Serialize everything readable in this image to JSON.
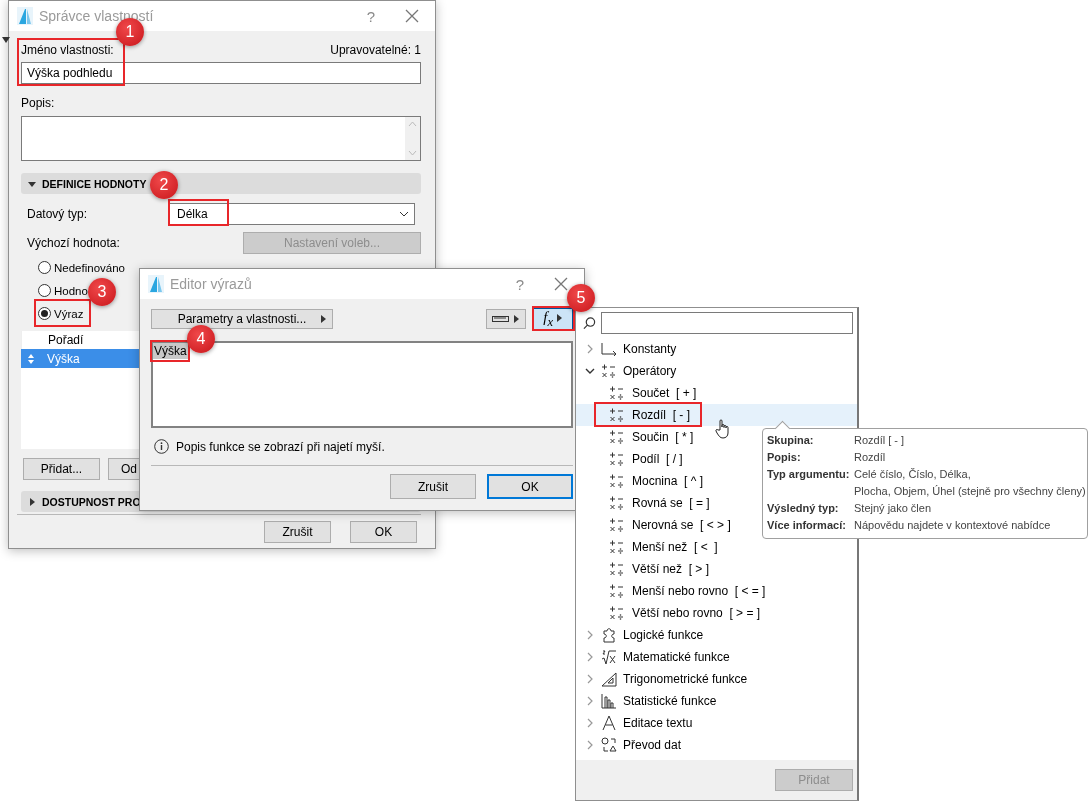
{
  "property_manager": {
    "title": "Správce vlastností",
    "help": "?",
    "name_label": "Jméno vlastnosti:",
    "editable_count": "Upravovatelné: 1",
    "name_value": "Výška podhledu",
    "description_label": "Popis:",
    "value_section": {
      "title": "DEFINICE HODNOTY",
      "expanded": true
    },
    "data_type_label": "Datový typ:",
    "data_type_value": "Délka",
    "default_label": "Výchozí hodnota:",
    "options_button": {
      "label": "Nastavení voleb...",
      "disabled": true
    },
    "radios": [
      {
        "label": "Nedefinováno",
        "selected": false
      },
      {
        "label": "Hodno",
        "selected": false
      },
      {
        "label": "Výraz",
        "selected": true
      }
    ],
    "table": {
      "column": "Pořadí",
      "rows": [
        {
          "label": "Výška",
          "selected": true
        }
      ]
    },
    "table_buttons": [
      "Přidat...",
      "Od"
    ],
    "access_section": {
      "title": "DOSTUPNOST PRO",
      "expanded": false
    },
    "buttons": [
      "Zrušit",
      "OK"
    ]
  },
  "expression_editor": {
    "title": "Editor výrazů",
    "help": "?",
    "params_button": "Parametry a vlastnosti...",
    "function_button": {
      "label": "f$_{x}$",
      "pressed": true
    },
    "expression": {
      "text": "Výška",
      "selected": true
    },
    "info": "Popis funkce se zobrazí při najetí myší.",
    "buttons": [
      {
        "label": "Zrušit",
        "default": false
      },
      {
        "label": "OK",
        "default": true
      }
    ]
  },
  "function_menu": {
    "tree": [
      {
        "label": "Konstanty",
        "kind": "constant",
        "expanded": false
      },
      {
        "label": "Operátory",
        "kind": "operator",
        "expanded": true,
        "children": [
          {
            "label": "Součet  [ + ]",
            "selected": false
          },
          {
            "label": "Rozdíl  [ - ]",
            "selected": true
          },
          {
            "label": "Součin  [ * ]",
            "selected": false
          },
          {
            "label": "Podíl  [ / ]",
            "selected": false
          },
          {
            "label": "Mocnina  [ ^ ]",
            "selected": false
          },
          {
            "label": "Rovná se  [ = ]",
            "selected": false
          },
          {
            "label": "Nerovná se  [ < > ]",
            "selected": false
          },
          {
            "label": "Menší než  [ <  ]",
            "selected": false
          },
          {
            "label": "Větší než  [ > ]",
            "selected": false
          },
          {
            "label": "Menší nebo rovno  [ < = ]",
            "selected": false
          },
          {
            "label": "Větší nebo rovno  [ > = ]",
            "selected": false
          }
        ]
      },
      {
        "label": "Logické funkce",
        "kind": "logic",
        "expanded": false
      },
      {
        "label": "Matematické funkce",
        "kind": "math",
        "expanded": false
      },
      {
        "label": "Trigonometrické funkce",
        "kind": "trig",
        "expanded": false
      },
      {
        "label": "Statistické funkce",
        "kind": "stat",
        "expanded": false
      },
      {
        "label": "Editace textu",
        "kind": "text",
        "expanded": false
      },
      {
        "label": "Převod dat",
        "kind": "convert",
        "expanded": false
      }
    ],
    "add_button": {
      "label": "Přidat",
      "disabled": true
    }
  },
  "tooltip": [
    {
      "label": "Skupina:",
      "lines": [
        "Rozdíl  [ - ]"
      ]
    },
    {
      "label": "Popis:",
      "lines": [
        "Rozdíl"
      ]
    },
    {
      "label": "Typ argumentu:",
      "lines": [
        "Celé číslo, Číslo, Délka,",
        "Plocha, Objem, Úhel (stejně pro všechny členy)"
      ]
    },
    {
      "label": "Výsledný typ:",
      "lines": [
        "Stejný jako člen"
      ]
    },
    {
      "label": "Více informací:",
      "lines": [
        "Nápovědu najdete v kontextové nabídce"
      ]
    }
  ],
  "callouts": [
    "1",
    "2",
    "3",
    "4",
    "5"
  ]
}
